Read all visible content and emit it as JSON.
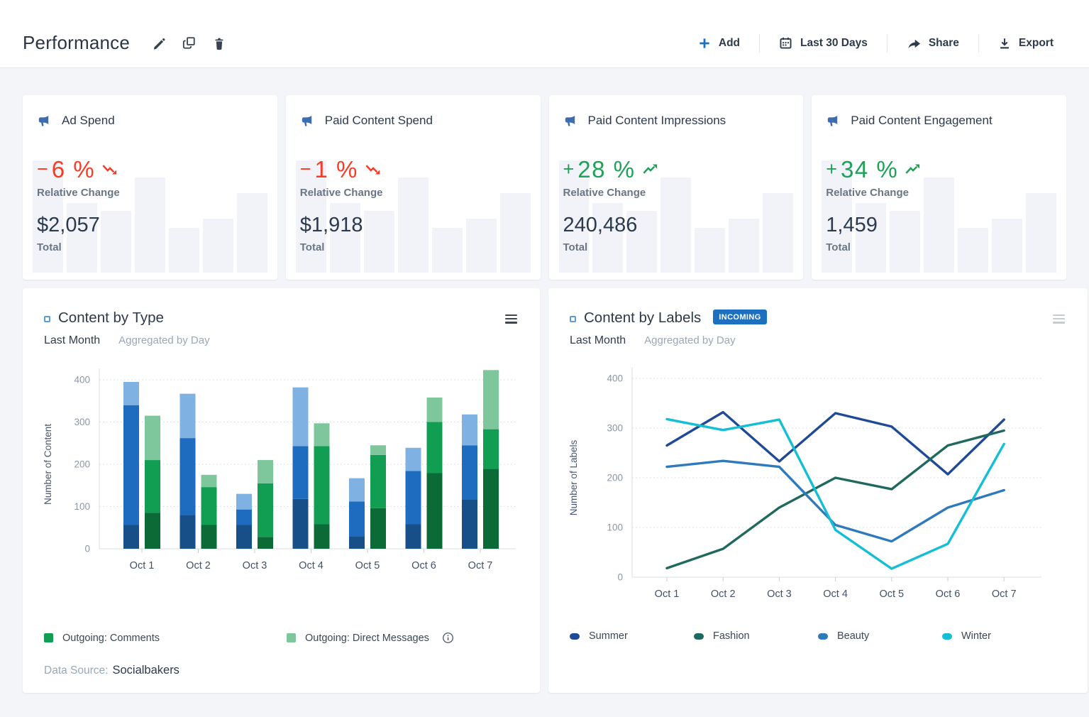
{
  "header": {
    "title": "Performance",
    "add_label": "Add",
    "date_range_label": "Last 30 Days",
    "share_label": "Share",
    "export_label": "Export"
  },
  "kpi": {
    "background_bars": [
      100,
      62,
      55,
      85,
      40,
      48,
      71
    ],
    "cards": [
      {
        "title": "Ad Spend",
        "sign": "−",
        "change": "6 %",
        "trend": "down",
        "change_label": "Relative Change",
        "total": "$2,057",
        "total_label": "Total"
      },
      {
        "title": "Paid Content Spend",
        "sign": "−",
        "change": "1 %",
        "trend": "down",
        "change_label": "Relative Change",
        "total": "$1,918",
        "total_label": "Total"
      },
      {
        "title": "Paid Content Impressions",
        "sign": "+",
        "change": "28 %",
        "trend": "up",
        "change_label": "Relative Change",
        "total": "240,486",
        "total_label": "Total"
      },
      {
        "title": "Paid Content Engagement",
        "sign": "+",
        "change": "34 %",
        "trend": "up",
        "change_label": "Relative Change",
        "total": "1,459",
        "total_label": "Total"
      }
    ]
  },
  "content_by_type": {
    "title": "Content by Type",
    "period": "Last Month",
    "aggregation": "Aggregated by Day",
    "legend": [
      {
        "label": "Outgoing: Comments",
        "color": "#129e52"
      },
      {
        "label": "Outgoing: Direct Messages",
        "color": "#7ec79c"
      }
    ],
    "data_source_label": "Data Source:",
    "data_source_value": "Socialbakers"
  },
  "content_by_labels": {
    "title": "Content by Labels",
    "badge": "INCOMING",
    "period": "Last Month",
    "aggregation": "Aggregated by Day"
  },
  "chart_data": [
    {
      "type": "bar",
      "title": "Content by Type",
      "categories": [
        "Oct 1",
        "Oct 2",
        "Oct 3",
        "Oct 4",
        "Oct 5",
        "Oct 6",
        "Oct 7"
      ],
      "ylabel": "Number of Content",
      "ylim": [
        0,
        400
      ],
      "yticks": [
        0,
        100,
        200,
        300,
        400
      ],
      "grid": "dotted-horizontal",
      "stacks": [
        {
          "name": "outgoing-blue",
          "segments": [
            {
              "name": "blue-dark",
              "color": "#175088",
              "values": [
                57,
                80,
                57,
                118,
                30,
                58,
                117
              ]
            },
            {
              "name": "blue-mid",
              "color": "#1e6cc0",
              "values": [
                283,
                182,
                36,
                125,
                82,
                126,
                128
              ]
            },
            {
              "name": "blue-light",
              "color": "#7fb2e2",
              "values": [
                55,
                105,
                37,
                139,
                55,
                55,
                73
              ]
            }
          ]
        },
        {
          "name": "outgoing-green",
          "segments": [
            {
              "name": "green-dark",
              "color": "#0c6a37",
              "values": [
                85,
                57,
                28,
                58,
                96,
                179,
                189
              ]
            },
            {
              "name": "Outgoing: Comments",
              "color": "#129e52",
              "values": [
                125,
                89,
                127,
                185,
                126,
                121,
                94
              ]
            },
            {
              "name": "Outgoing: Direct Messages",
              "color": "#7ec79c",
              "values": [
                105,
                29,
                55,
                54,
                23,
                58,
                140
              ]
            }
          ]
        }
      ]
    },
    {
      "type": "line",
      "title": "Content by Labels",
      "x": [
        "Oct 1",
        "Oct 2",
        "Oct 3",
        "Oct 4",
        "Oct 5",
        "Oct 6",
        "Oct 7"
      ],
      "ylabel": "Number of Labels",
      "ylim": [
        0,
        400
      ],
      "yticks": [
        0,
        100,
        200,
        300,
        400
      ],
      "grid": "dotted-horizontal",
      "legend_position": "bottom",
      "series": [
        {
          "name": "Summer",
          "color": "#1e4a96",
          "values": [
            265,
            332,
            233,
            330,
            303,
            207,
            317
          ]
        },
        {
          "name": "Fashion",
          "color": "#20695f",
          "values": [
            18,
            57,
            140,
            200,
            177,
            265,
            295
          ]
        },
        {
          "name": "Beauty",
          "color": "#2e7abc",
          "values": [
            222,
            234,
            222,
            105,
            72,
            140,
            175
          ]
        },
        {
          "name": "Winter",
          "color": "#14bfd6",
          "values": [
            318,
            296,
            317,
            95,
            17,
            67,
            268
          ]
        }
      ]
    }
  ],
  "colors": {
    "accent_blue": "#1d6fc0",
    "negative_red": "#f93b26",
    "positive_green": "#1da258",
    "page_bg": "#f3f5f9",
    "minibar": "#f1f3f8"
  }
}
